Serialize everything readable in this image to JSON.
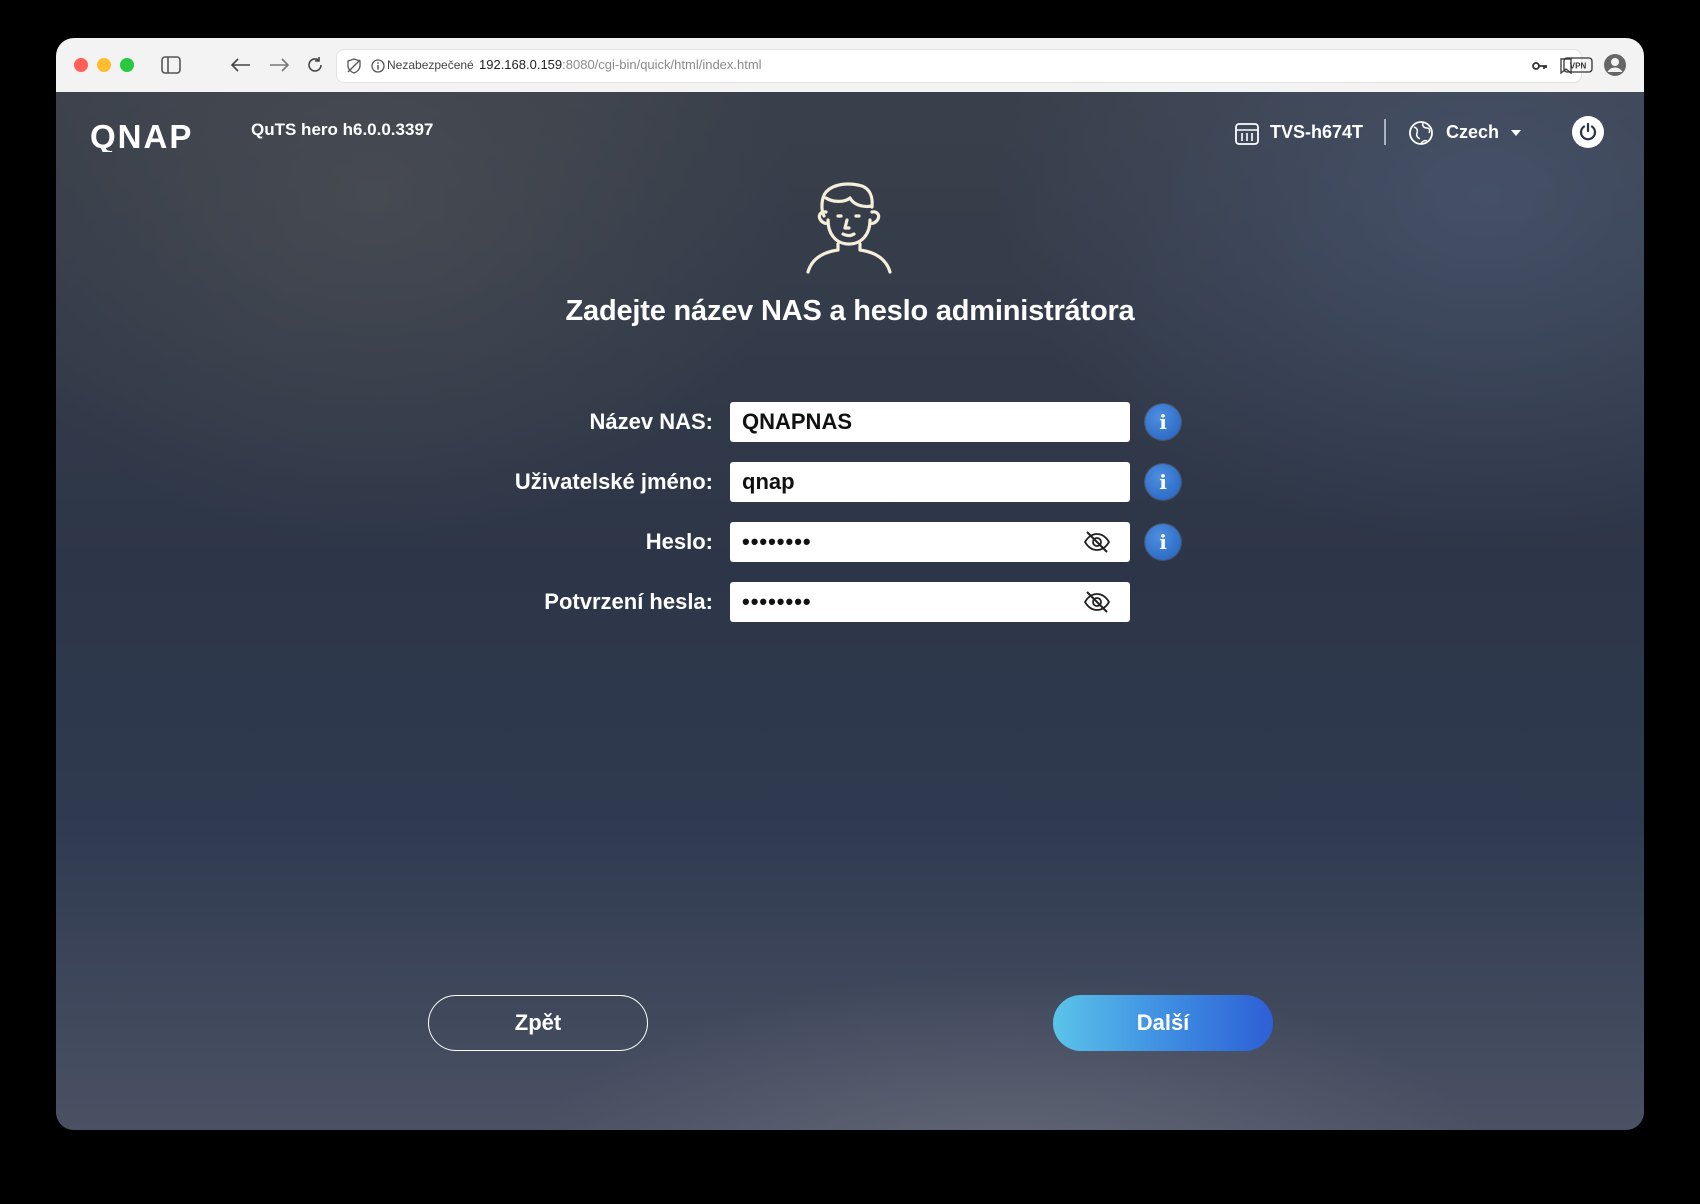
{
  "browser": {
    "security_label": "Nezabezpečené",
    "url_host": "192.168.0.159",
    "url_path": ":8080/cgi-bin/quick/html/index.html",
    "vpn_label": "VPN"
  },
  "header": {
    "logo_text": "QNAP",
    "version": "QuTS hero h6.0.0.3397",
    "device_name": "TVS-h674T",
    "language": "Czech"
  },
  "page": {
    "title": "Zadejte název NAS a heslo administrátora"
  },
  "form": {
    "nas_name_label": "Název NAS:",
    "nas_name_value": "QNAPNAS",
    "username_label": "Uživatelské jméno:",
    "username_value": "qnap",
    "password_label": "Heslo:",
    "password_value": "••••••••",
    "confirm_label": "Potvrzení hesla:",
    "confirm_value": "••••••••",
    "info_glyph": "i"
  },
  "footer": {
    "back_label": "Zpět",
    "next_label": "Další"
  },
  "colors": {
    "accent": "#2d5fd6",
    "info": "#2f6fd0"
  }
}
